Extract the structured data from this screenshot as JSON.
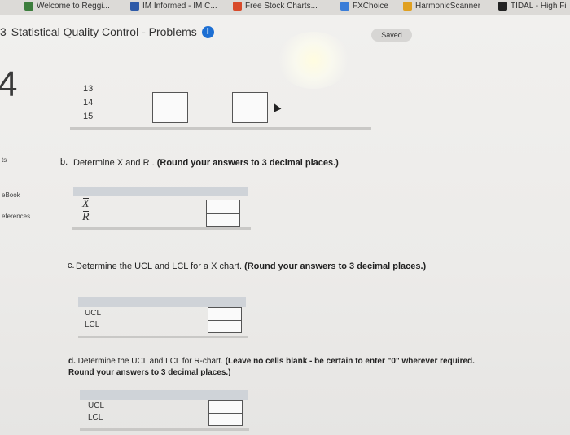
{
  "bookmarks": [
    {
      "label": "Welcome to Reggi...",
      "color": "#3c7d3c"
    },
    {
      "label": "IM Informed - IM C...",
      "color": "#2e5aa8"
    },
    {
      "label": "Free Stock Charts...",
      "color": "#d84a2a"
    },
    {
      "label": "FXChoice",
      "color": "#3a7dd8"
    },
    {
      "label": "HarmonicScanner",
      "color": "#e0a020"
    },
    {
      "label": "TIDAL - High Fi",
      "color": "#222222"
    }
  ],
  "header": {
    "title": "Statistical Quality Control - Problems",
    "title_prefix": "3",
    "saved": "Saved"
  },
  "question_number": "4",
  "sidebar": {
    "item1": "ts",
    "ebook": "eBook",
    "references": "eferences"
  },
  "rows": [
    "13",
    "14",
    "15"
  ],
  "part_b": {
    "label": "b.",
    "text": "Determine X and R .",
    "bold": "(Round your answers to 3 decimal places.)",
    "row1": "X",
    "row2": "R"
  },
  "part_c": {
    "label": "c.",
    "text": "Determine the UCL and LCL for a X chart.",
    "bold": "(Round your answers to 3 decimal places.)",
    "row1": "UCL",
    "row2": "LCL"
  },
  "part_d": {
    "label": "d.",
    "text": "Determine the UCL and LCL for R-chart.",
    "bold": "(Leave no cells blank - be certain to enter \"0\" wherever required. Round your answers to 3 decimal places.)",
    "row1": "UCL",
    "row2": "LCL"
  }
}
